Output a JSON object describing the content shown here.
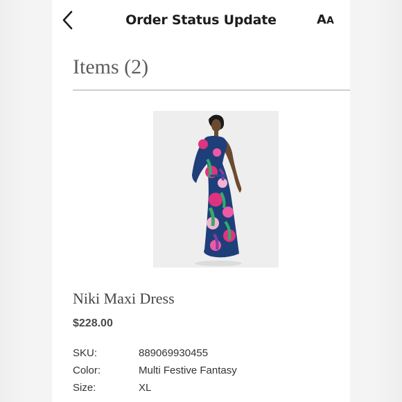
{
  "header": {
    "title": "Order Status Update",
    "text_size_big": "A",
    "text_size_small": "A"
  },
  "items_heading": "Items (2)",
  "product": {
    "image": "woman in one-shoulder floral maxi dress",
    "name": "Niki Maxi Dress",
    "price": "$228.00",
    "details": [
      {
        "label": "SKU:",
        "value": "889069930455"
      },
      {
        "label": "Color:",
        "value": "Multi Festive Fantasy"
      },
      {
        "label": "Size:",
        "value": "XL"
      }
    ]
  },
  "colors": {
    "title": "#1c1c1c",
    "heading": "#5c5c5c",
    "divider": "#cfcfcf",
    "price": "#4a4a4a"
  }
}
